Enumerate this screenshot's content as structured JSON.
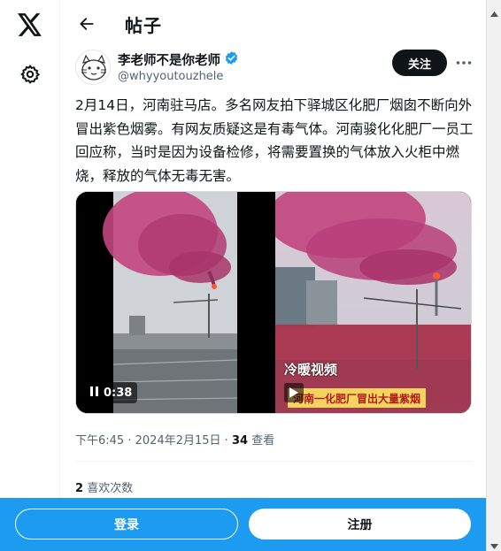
{
  "app": {
    "logo_icon": "x-logo-icon",
    "settings_icon": "gear-icon"
  },
  "header": {
    "title": "帖子",
    "back_icon": "arrow-left-icon"
  },
  "author": {
    "name": "李老师不是你老师",
    "handle": "@whyyoutouzhele",
    "verified": true,
    "follow_label": "关注",
    "more_icon": "more-horizontal-icon"
  },
  "tweet": {
    "text": "2月14日，河南驻马店。多名网友拍下驿城区化肥厂烟囱不断向外冒出紫色烟雾。有网友质疑这是有毒气体。河南骏化化肥厂一员工回应称，当时是因为设备检修，将需要置换的气体放入火柜中燃烧，释放的气体无毒无害。"
  },
  "media": {
    "left_video": {
      "duration": "0:38",
      "pause_icon": "pause-icon"
    },
    "right_video": {
      "watermark": "冷暖视频",
      "caption": "河南一化肥厂冒出大量紫烟",
      "play_icon": "play-icon"
    }
  },
  "meta": {
    "time": "下午6:45",
    "date": "2024年2月15日",
    "separator": "·",
    "views_count": "34",
    "views_label": "查看"
  },
  "engagement": {
    "likes_count": "2",
    "likes_label": "喜欢次数"
  },
  "bottom_bar": {
    "login_label": "登录",
    "signup_label": "注册"
  },
  "colors": {
    "accent": "#1d9bf0",
    "text": "#0f1419",
    "muted": "#536471",
    "smoke": "#c2457e"
  }
}
